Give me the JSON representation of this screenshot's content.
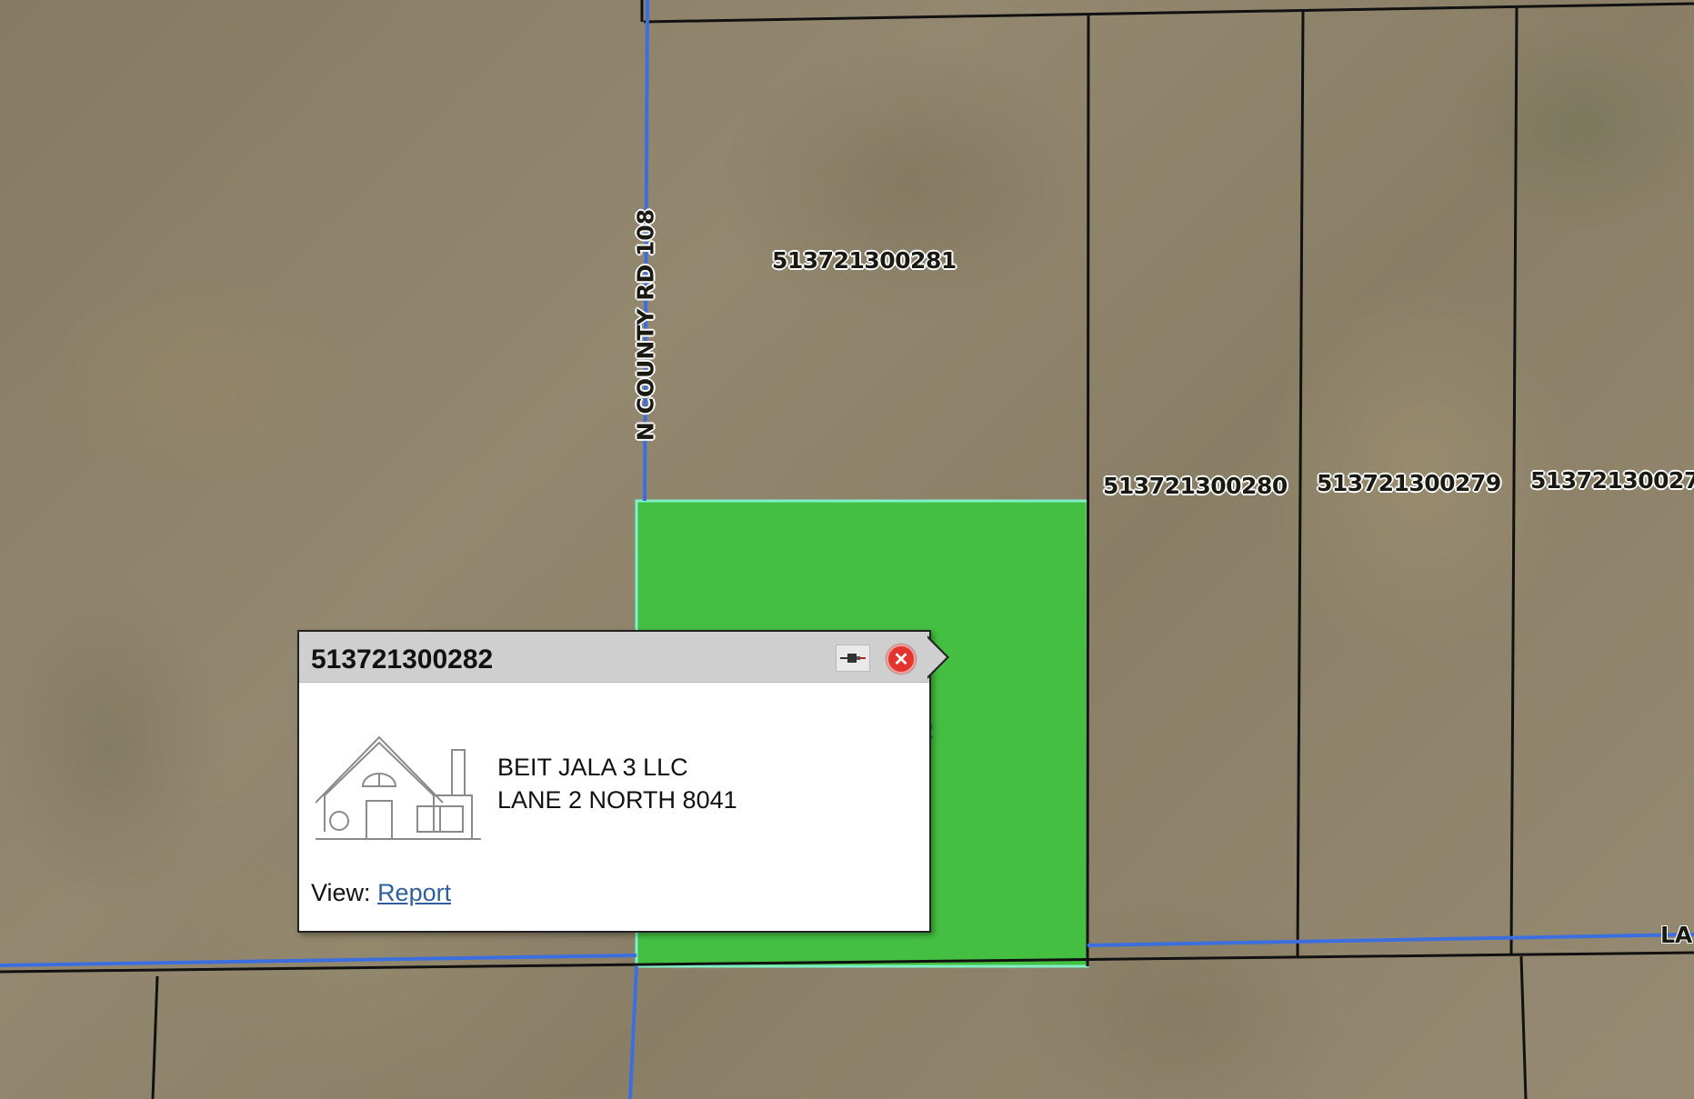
{
  "map": {
    "road_labels": {
      "county_road": "N COUNTY RD 108",
      "lane_partial": "LA"
    },
    "parcel_labels": [
      "513721300281",
      "513721300280",
      "513721300279",
      "51372130027"
    ],
    "selected_parcel_partial_label": "2",
    "colors": {
      "selection_fill": "#3ec43e",
      "selection_outline": "#7ff0c8",
      "road_line": "#3b6fe0",
      "parcel_line": "#111111"
    }
  },
  "popup": {
    "title": "513721300282",
    "pin_icon": "pin-icon",
    "close_icon": "close-icon",
    "close_glyph": "✕",
    "owner_name": "BEIT JALA 3 LLC",
    "owner_address": "LANE 2 NORTH 8041",
    "view_label": "View:",
    "report_link": "Report"
  }
}
